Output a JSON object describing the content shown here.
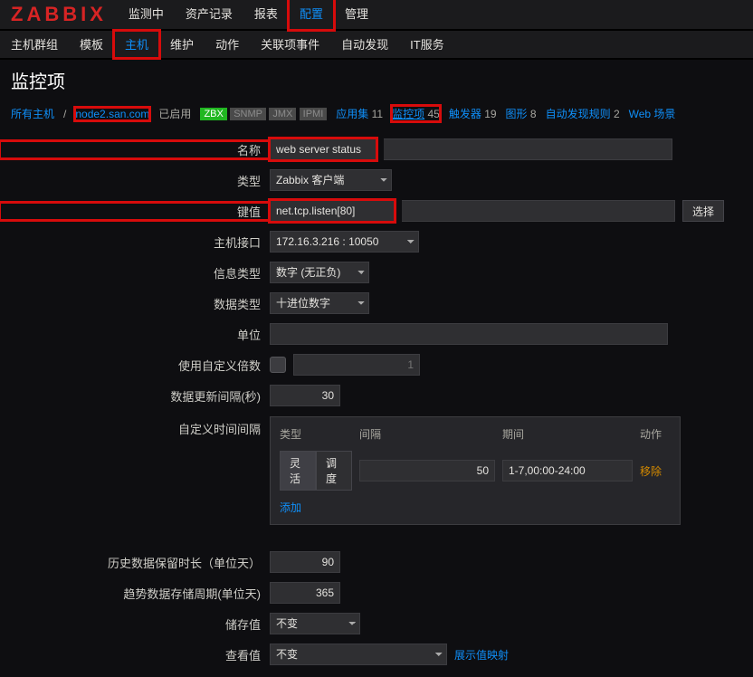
{
  "logo": "ZABBIX",
  "nav1": {
    "items": [
      "监测中",
      "资产记录",
      "报表",
      "配置",
      "管理"
    ],
    "active": "配置"
  },
  "nav2": {
    "items": [
      "主机群组",
      "模板",
      "主机",
      "维护",
      "动作",
      "关联项事件",
      "自动发现",
      "IT服务"
    ],
    "active": "主机"
  },
  "page_title": "监控项",
  "hostbar": {
    "all_hosts": "所有主机",
    "host": "node2.san.com",
    "enabled": "已启用",
    "badges": [
      "ZBX",
      "SNMP",
      "JMX",
      "IPMI"
    ],
    "links": [
      {
        "label": "应用集",
        "count": "11"
      },
      {
        "label": "监控项",
        "count": "45",
        "hl": true
      },
      {
        "label": "触发器",
        "count": "19"
      },
      {
        "label": "图形",
        "count": "8"
      },
      {
        "label": "自动发现规则",
        "count": "2"
      },
      {
        "label": "Web 场景",
        "count": ""
      }
    ]
  },
  "form": {
    "name": {
      "label": "名称",
      "value": "web server status"
    },
    "type": {
      "label": "类型",
      "value": "Zabbix 客户端"
    },
    "key": {
      "label": "键值",
      "value": "net.tcp.listen[80]",
      "select_btn": "选择"
    },
    "iface": {
      "label": "主机接口",
      "value": "172.16.3.216 : 10050"
    },
    "info": {
      "label": "信息类型",
      "value": "数字 (无正负)"
    },
    "data": {
      "label": "数据类型",
      "value": "十进位数字"
    },
    "unit": {
      "label": "单位",
      "value": ""
    },
    "mult": {
      "label": "使用自定义倍数",
      "placeholder": "1"
    },
    "upd": {
      "label": "数据更新间隔(秒)",
      "value": "30"
    },
    "cust": {
      "label": "自定义时间间隔",
      "h": {
        "type": "类型",
        "int": "间隔",
        "per": "期间",
        "act": "动作"
      },
      "toggle": [
        "灵活",
        "调度"
      ],
      "row": {
        "int": "50",
        "per": "1-7,00:00-24:00"
      },
      "remove": "移除",
      "add": "添加"
    },
    "hist": {
      "label": "历史数据保留时长（单位天）",
      "value": "90"
    },
    "trend": {
      "label": "趋势数据存储周期(单位天)",
      "value": "365"
    },
    "store": {
      "label": "储存值",
      "value": "不变"
    },
    "view": {
      "label": "查看值",
      "value": "不变",
      "link": "展示值映射"
    }
  }
}
